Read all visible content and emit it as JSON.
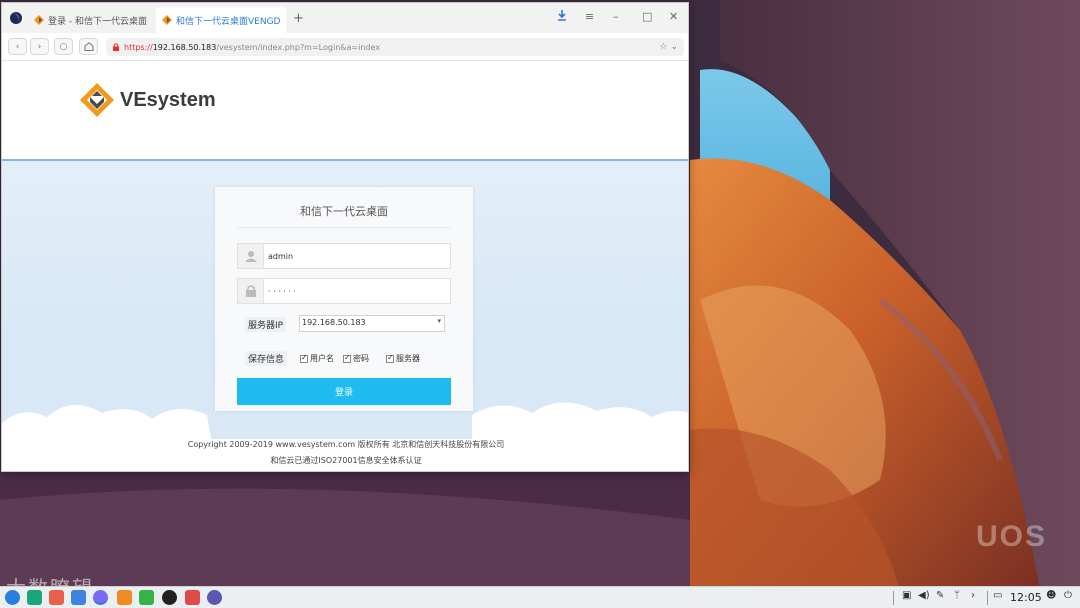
{
  "browser": {
    "tabs": [
      {
        "label": "登录 - 和信下一代云桌面",
        "active": false
      },
      {
        "label": "和信下一代云桌面VENGD",
        "active": true
      }
    ],
    "url": {
      "scheme": "https://",
      "host": "192.168.50.183",
      "path": "/vesystem/index.php?m=Login&a=index"
    },
    "nav_icons": [
      "back-icon",
      "forward-icon",
      "reload-icon",
      "home-icon"
    ],
    "window_icons": [
      "download-icon",
      "menu-icon",
      "minimize-icon",
      "maximize-icon",
      "close-icon"
    ]
  },
  "page": {
    "brand": "VEsystem",
    "login": {
      "title": "和信下一代云桌面",
      "username_value": "admin",
      "password_mask": "· · · · · ·",
      "server_ip_label": "服务器IP",
      "server_ip_value": "192.168.50.183",
      "save_info_label": "保存信息",
      "save_options": [
        {
          "label": "用户名",
          "checked": true
        },
        {
          "label": "密码",
          "checked": true
        },
        {
          "label": "服务器",
          "checked": true
        }
      ],
      "login_button": "登录"
    },
    "footer": {
      "copyright": "Copyright 2009-2019 www.vesystem.com 版权所有 北京和信创天科技股份有限公司",
      "certification": "和信云已通过ISO27001信息安全体系认证"
    }
  },
  "desktop": {
    "os_mark": "UOS",
    "watermark": "大数瞭望"
  },
  "taskbar": {
    "clock": "12:05"
  },
  "colors": {
    "login_button": "#1ebbf0",
    "header_rule": "#7fb9ea",
    "active_tab": "#2b7ad8",
    "url_https": "#e03030"
  }
}
